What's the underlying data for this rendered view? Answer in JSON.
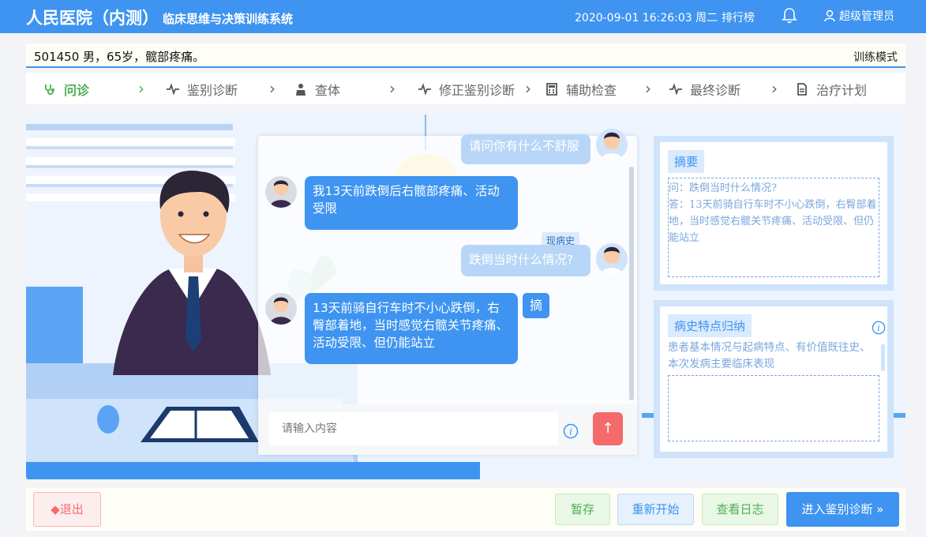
{
  "header": {
    "brand": "人民医院（内测）",
    "subtitle": "临床思维与决策训练系统",
    "datetime": "2020-09-01 16:26:03 周二",
    "ranking": "排行榜",
    "user": "超级管理员"
  },
  "patient": {
    "info": "501450 男，65岁，髋部疼痛。",
    "mode": "训练模式"
  },
  "steps": [
    {
      "label": "问诊",
      "icon": "stethoscope-icon"
    },
    {
      "label": "鉴别诊断",
      "icon": "pulse-icon"
    },
    {
      "label": "查体",
      "icon": "doctor-icon"
    },
    {
      "label": "修正鉴别诊断",
      "icon": "pulse-icon"
    },
    {
      "label": "辅助检查",
      "icon": "calculator-icon"
    },
    {
      "label": "最终诊断",
      "icon": "pulse-icon"
    },
    {
      "label": "治疗计划",
      "icon": "document-icon"
    }
  ],
  "chat": {
    "messages": [
      {
        "role": "doctor",
        "text": "请问你有什么不舒服"
      },
      {
        "role": "patient",
        "text": "我13天前跌倒后右髋部疼痛、活动受限"
      },
      {
        "role": "doctor",
        "text": "跌倒当时什么情况?",
        "tag": "现病史"
      },
      {
        "role": "patient",
        "text": "13天前骑自行车时不小心跌倒，右臀部着地，当时感觉右髋关节疼痛、活动受限、但仍能站立"
      }
    ],
    "excerpt_label": "摘",
    "input_placeholder": "请输入内容",
    "send_icon": "arrow-up-icon"
  },
  "summary": {
    "title": "摘要",
    "question": "问：跌倒当时什么情况?",
    "answer": "答：13天前骑自行车时不小心跌倒，右臀部着地，当时感觉右髋关节疼痛、活动受限、但仍能站立"
  },
  "history": {
    "title": "病史特点归纳",
    "hint": "患者基本情况与起病特点、有价值既往史、本次发病主要临床表现",
    "value": ""
  },
  "buttons": {
    "exit": "◆退出",
    "save": "暂存",
    "restart": "重新开始",
    "log": "查看日志",
    "next": "进入鉴别诊断 »"
  },
  "colors": {
    "primary": "#3e94f0",
    "active_step": "#4caf50",
    "send": "#f56a6a"
  }
}
